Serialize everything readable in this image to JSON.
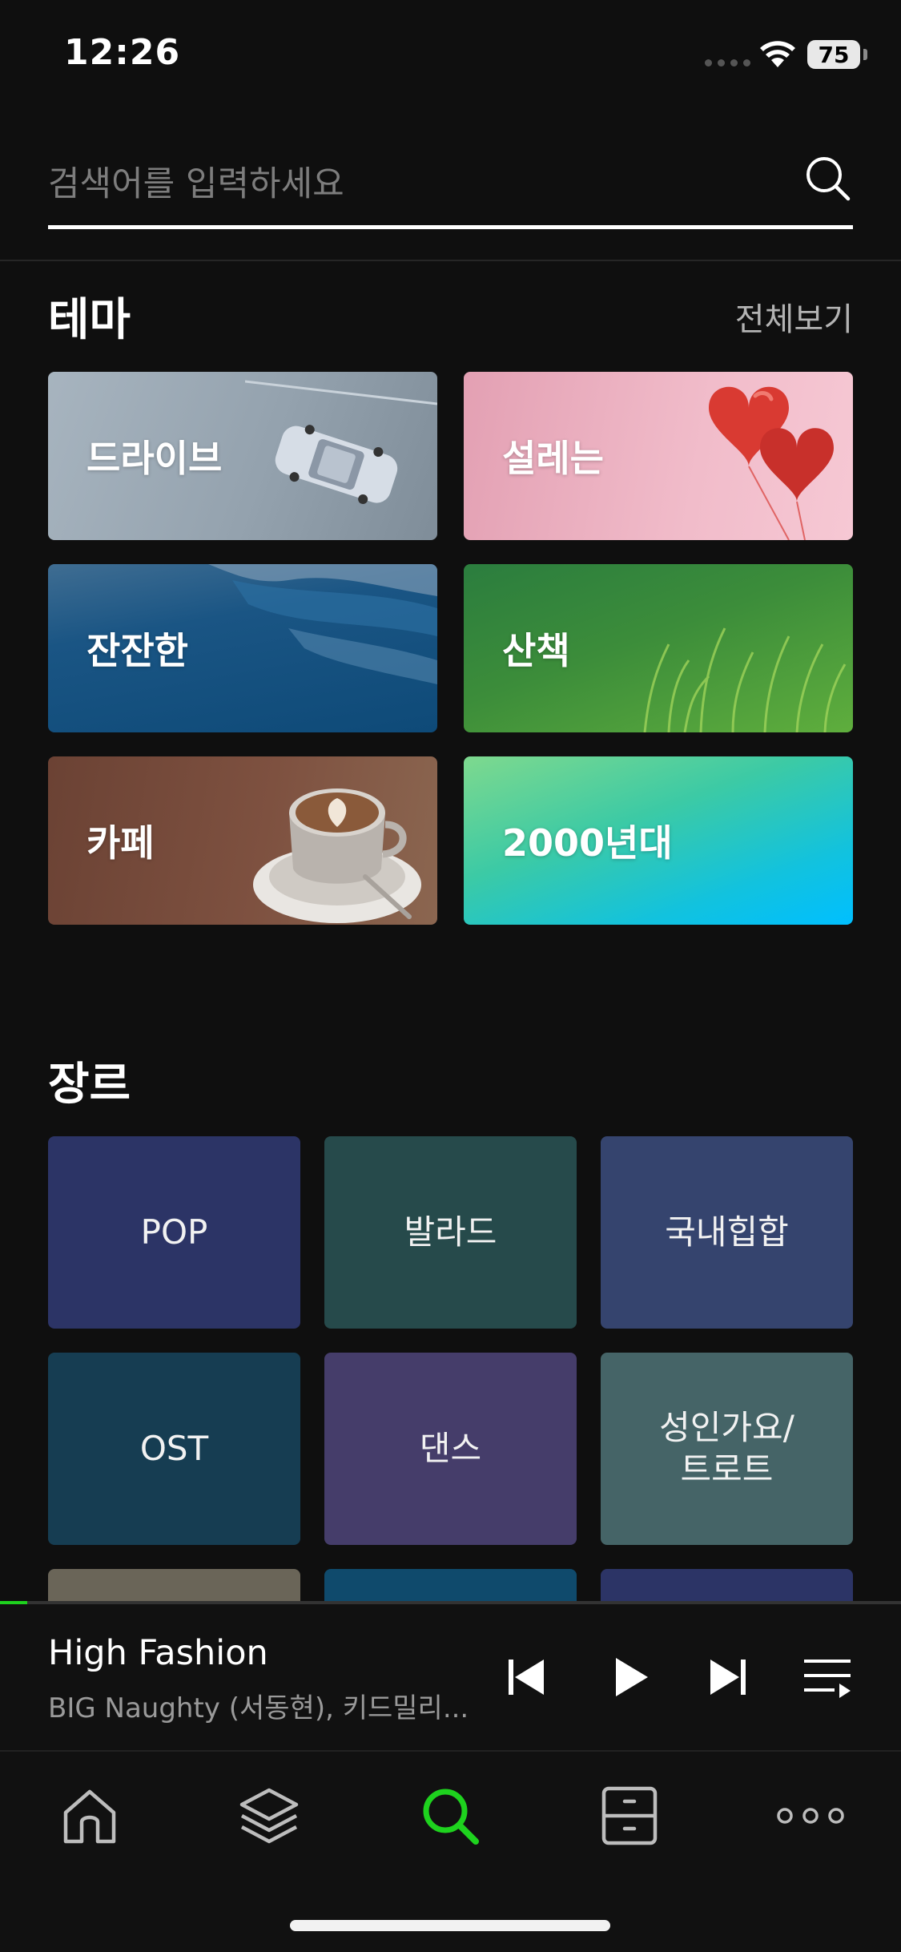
{
  "status_bar": {
    "time": "12:26",
    "battery": "75"
  },
  "search": {
    "placeholder": "검색어를 입력하세요",
    "icon": "search-icon"
  },
  "theme_section": {
    "title": "테마",
    "see_all": "전체보기",
    "cards": [
      {
        "label": "드라이브",
        "art": "car-image"
      },
      {
        "label": "설레는",
        "art": "heart-balloons-image"
      },
      {
        "label": "잔잔한",
        "art": "ocean-wave-image"
      },
      {
        "label": "산책",
        "art": "grass-field-image"
      },
      {
        "label": "카페",
        "art": "latte-cup-image"
      },
      {
        "label": "2000년대",
        "art": "gradient"
      }
    ]
  },
  "genre_section": {
    "title": "장르",
    "tiles": [
      {
        "label": "POP",
        "color": "#2c3466"
      },
      {
        "label": "발라드",
        "color": "#264a4b"
      },
      {
        "label": "국내힙합",
        "color": "#35446e"
      },
      {
        "label": "OST",
        "color": "#163d52"
      },
      {
        "label": "댄스",
        "color": "#453d6a"
      },
      {
        "label": "성인가요/\n트로트",
        "color": "#456467"
      },
      {
        "label": "",
        "color": "#6a6558"
      },
      {
        "label": "",
        "color": "#0f4a6c"
      },
      {
        "label": "",
        "color": "#2c3466"
      }
    ]
  },
  "player": {
    "title": "High Fashion",
    "artist": "BIG Naughty (서동현), 키드밀리...",
    "progress": 0.03,
    "accent": "#1ed21e"
  },
  "tab_bar": {
    "tabs": [
      {
        "icon": "home-icon",
        "active": false
      },
      {
        "icon": "layers-icon",
        "active": false
      },
      {
        "icon": "search-icon",
        "active": true
      },
      {
        "icon": "library-cabinet-icon",
        "active": false
      },
      {
        "icon": "more-icon",
        "active": false
      }
    ],
    "active_color": "#1ed21e"
  }
}
